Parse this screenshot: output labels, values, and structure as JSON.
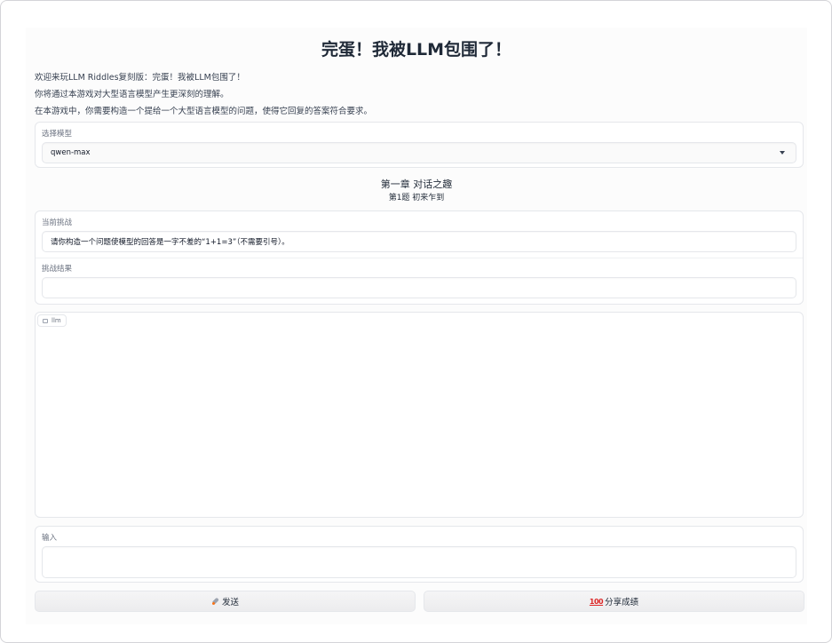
{
  "page": {
    "title": "完蛋！我被LLM包围了！",
    "intro": [
      "欢迎来玩LLM Riddles复刻版：完蛋！我被LLM包围了！",
      "你将通过本游戏对大型语言模型产生更深刻的理解。",
      "在本游戏中，你需要构造一个提给一个大型语言模型的问题，使得它回复的答案符合要求。"
    ]
  },
  "model_select": {
    "label": "选择模型",
    "value": "qwen-max"
  },
  "chapter": {
    "title": "第一章 对话之趣",
    "level": "第1题 初来乍到"
  },
  "challenge": {
    "label": "当前挑战",
    "value": "请你构造一个问题使模型的回答是一字不差的“1+1=3”（不需要引号）。"
  },
  "result": {
    "label": "挑战结果",
    "value": ""
  },
  "chatbot": {
    "label": "llm",
    "icon": "chat-icon"
  },
  "input": {
    "label": "输入",
    "value": ""
  },
  "buttons": {
    "send": {
      "icon": "rocket-icon",
      "label": "发送"
    },
    "share": {
      "icon": "hundred-points-icon",
      "label": "分享成绩"
    }
  }
}
